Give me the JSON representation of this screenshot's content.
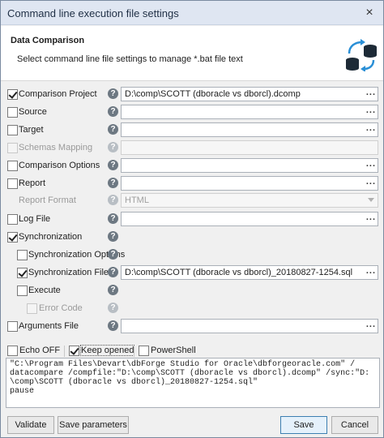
{
  "window": {
    "title": "Command line execution file settings"
  },
  "header": {
    "title": "Data Comparison",
    "subtitle": "Select command line file settings to manage *.bat file text",
    "icon": "database-sync-icon"
  },
  "rows": {
    "comparison_project": {
      "label": "Comparison Project",
      "checked": true,
      "value": "D:\\comp\\SCOTT (dboracle vs dborcl).dcomp"
    },
    "source": {
      "label": "Source",
      "checked": false
    },
    "target": {
      "label": "Target",
      "checked": false
    },
    "schemas_mapping": {
      "label": "Schemas Mapping",
      "checked": false,
      "disabled": true
    },
    "comparison_options": {
      "label": "Comparison Options",
      "checked": false
    },
    "report": {
      "label": "Report",
      "checked": false
    },
    "report_format": {
      "label": "Report Format",
      "value": "HTML",
      "disabled": true
    },
    "log_file": {
      "label": "Log File",
      "checked": false
    },
    "synchronization": {
      "label": "Synchronization",
      "checked": true
    },
    "synchronization_options": {
      "label": "Synchronization Options",
      "checked": false
    },
    "synchronization_file": {
      "label": "Synchronization File",
      "checked": true,
      "value": "D:\\comp\\SCOTT (dboracle vs dborcl)_20180827-1254.sql"
    },
    "execute": {
      "label": "Execute",
      "checked": false
    },
    "error_code": {
      "label": "Error Code",
      "checked": false,
      "disabled": true
    },
    "arguments_file": {
      "label": "Arguments File",
      "checked": false
    }
  },
  "options": {
    "echo_off": {
      "label": "Echo OFF",
      "checked": false
    },
    "keep_opened": {
      "label": "Keep opened",
      "checked": true
    },
    "powershell": {
      "label": "PowerShell",
      "checked": false
    }
  },
  "command_text": "\"C:\\Program Files\\Devart\\dbForge Studio for Oracle\\dbforgeoracle.com\" /\ndatacompare /compfile:\"D:\\comp\\SCOTT (dboracle vs dborcl).dcomp\" /sync:\"D:\n\\comp\\SCOTT (dboracle vs dborcl)_20180827-1254.sql\"\npause",
  "buttons": {
    "validate": "Validate",
    "save_parameters": "Save parameters",
    "save": "Save",
    "cancel": "Cancel"
  },
  "browse_label": "...",
  "help_glyph": "?"
}
